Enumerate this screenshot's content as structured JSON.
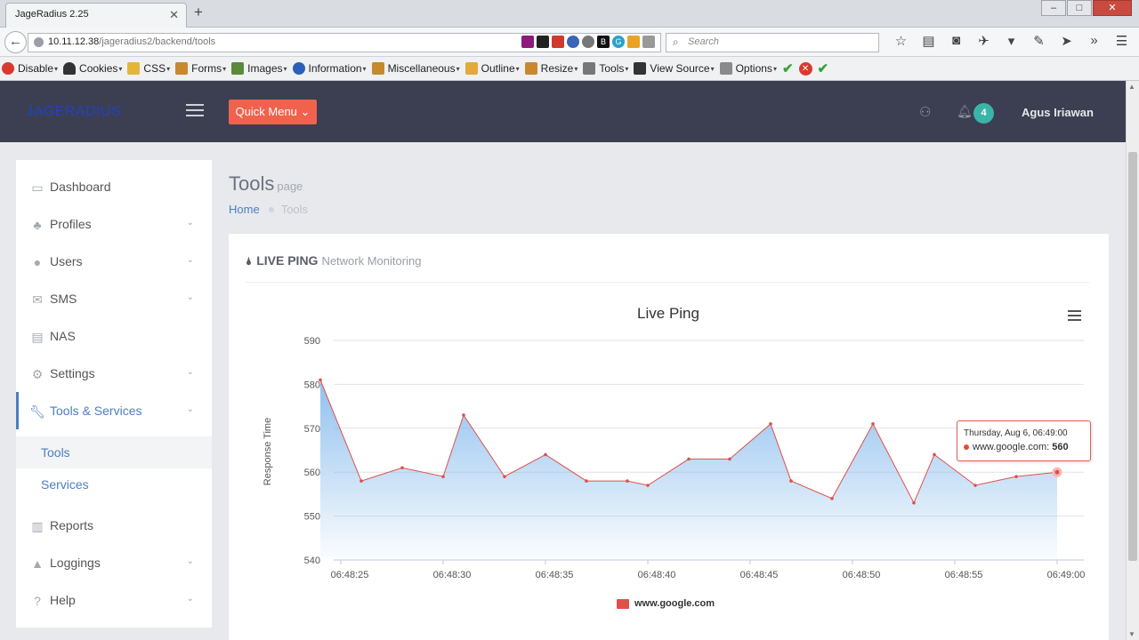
{
  "browser": {
    "tab_title": "JageRadius 2.25",
    "url_host": "10.11.12.38",
    "url_path": "/jageradius2/backend/tools",
    "search_placeholder": "Search",
    "ext_labels": [
      "B",
      "G"
    ]
  },
  "webdev_toolbar": {
    "items": [
      "Disable",
      "Cookies",
      "CSS",
      "Forms",
      "Images",
      "Information",
      "Miscellaneous",
      "Outline",
      "Resize",
      "Tools",
      "View Source",
      "Options"
    ]
  },
  "app": {
    "logo": "JAGERADIUS",
    "quick_menu": "Quick Menu",
    "notif_count": "4",
    "user_name": "Agus Iriawan"
  },
  "sidebar": {
    "items": [
      {
        "label": "Dashboard"
      },
      {
        "label": "Profiles"
      },
      {
        "label": "Users"
      },
      {
        "label": "SMS"
      },
      {
        "label": "NAS"
      },
      {
        "label": "Settings"
      },
      {
        "label": "Tools & Services"
      },
      {
        "label": "Tools"
      },
      {
        "label": "Services"
      },
      {
        "label": "Reports"
      },
      {
        "label": "Loggings"
      },
      {
        "label": "Help"
      }
    ]
  },
  "page": {
    "title": "Tools",
    "subtitle": "page",
    "crumb_home": "Home",
    "crumb_current": "Tools",
    "panel_title": "LIVE PING",
    "panel_subtitle": "Network Monitoring"
  },
  "tooltip": {
    "date": "Thursday, Aug 6, 06:49:00",
    "series": "www.google.com",
    "value": "560"
  },
  "chart_data": {
    "type": "area",
    "title": "Live Ping",
    "ylabel": "Response Time",
    "xlabel": "",
    "ylim": [
      540,
      590
    ],
    "yticks": [
      "540",
      "550",
      "560",
      "570",
      "580",
      "590"
    ],
    "xticks": [
      "06:48:25",
      "06:48:30",
      "06:48:35",
      "06:48:40",
      "06:48:45",
      "06:48:50",
      "06:48:55",
      "06:49:00"
    ],
    "series": [
      {
        "name": "www.google.com",
        "values": [
          581,
          558,
          561,
          559,
          573,
          559,
          564,
          558,
          558,
          557,
          563,
          563,
          571,
          558,
          554,
          571,
          553,
          564,
          557,
          559,
          560
        ],
        "x_seconds_offset": [
          -1,
          1,
          3,
          5,
          6,
          8,
          10,
          12,
          14,
          15,
          17,
          19,
          21,
          22,
          24,
          26,
          28,
          29,
          31,
          33,
          35
        ]
      }
    ],
    "colors": {
      "line": "#e0504a",
      "fill": "#7cb5ec"
    },
    "legend": "bottom-center",
    "grid": true
  }
}
